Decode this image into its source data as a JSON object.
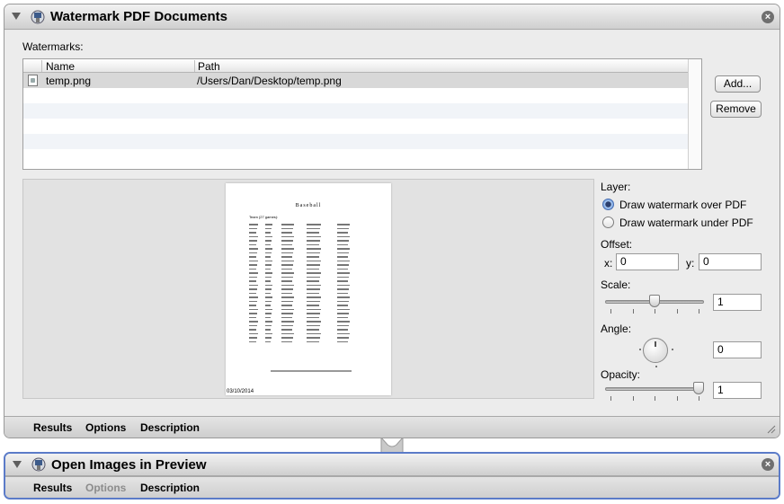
{
  "action1": {
    "title": "Watermark PDF Documents",
    "watermarks_label": "Watermarks:",
    "columns": [
      "Name",
      "Path"
    ],
    "rows": [
      {
        "name": "temp.png",
        "path": "/Users/Dan/Desktop/temp.png"
      }
    ],
    "add_label": "Add...",
    "remove_label": "Remove",
    "preview": {
      "doc_title": "Baseball",
      "doc_subtitle": "Team (27 games):",
      "date": "03/10/2014"
    },
    "layer_label": "Layer:",
    "layer_options": [
      "Draw watermark over PDF",
      "Draw watermark under PDF"
    ],
    "layer_selected": 0,
    "offset_label": "Offset:",
    "x_label": "x:",
    "x_value": "0",
    "y_label": "y:",
    "y_value": "0",
    "scale_label": "Scale:",
    "scale_value": "1",
    "scale_slider_fraction": 0.5,
    "angle_label": "Angle:",
    "angle_value": "0",
    "opacity_label": "Opacity:",
    "opacity_value": "1",
    "opacity_slider_fraction": 1.0,
    "tabs": [
      "Results",
      "Options",
      "Description"
    ]
  },
  "action2": {
    "title": "Open Images in Preview",
    "tabs": [
      "Results",
      "Options",
      "Description"
    ],
    "options_disabled": true
  },
  "colors": {
    "selection_border": "#5b7bc8",
    "selected_row": "#d8d8d8"
  },
  "icons": [
    "automator-icon",
    "close-icon",
    "disclosure-triangle-icon",
    "file-icon",
    "resize-grip-icon"
  ]
}
